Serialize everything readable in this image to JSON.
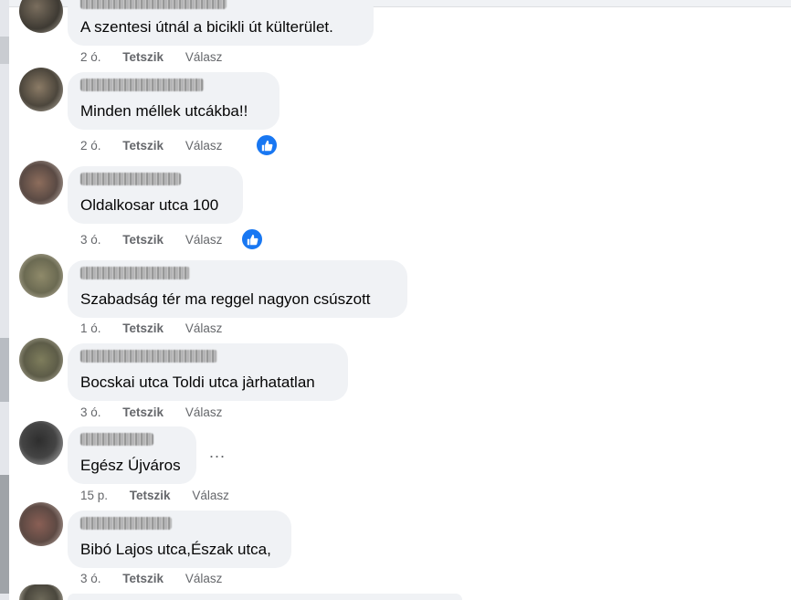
{
  "actions": {
    "like": "Tetszik",
    "reply": "Válasz"
  },
  "comments": [
    {
      "text": "A szentesi útnál a bicikli út külterület.",
      "time": "2 ó."
    },
    {
      "text": "Minden méllek utcákba!!",
      "time": "2 ó.",
      "reaction": "like-icon"
    },
    {
      "text": "Oldalkosar utca 100",
      "time": "3 ó.",
      "reaction": "like-icon"
    },
    {
      "text": "Szabadság tér ma reggel nagyon csúszott",
      "time": "1 ó."
    },
    {
      "text": "Bocskai utca Toldi utca jàrhatatlan",
      "time": "3 ó."
    },
    {
      "text": "Egész Újváros",
      "time": "15 p.",
      "more": "..."
    },
    {
      "text": "Bibó Lajos utca,Észak utca,",
      "time": "3 ó."
    }
  ],
  "colors": {
    "bubble": "#f0f2f5",
    "meta": "#65676b",
    "like_badge": "#1877f2"
  }
}
